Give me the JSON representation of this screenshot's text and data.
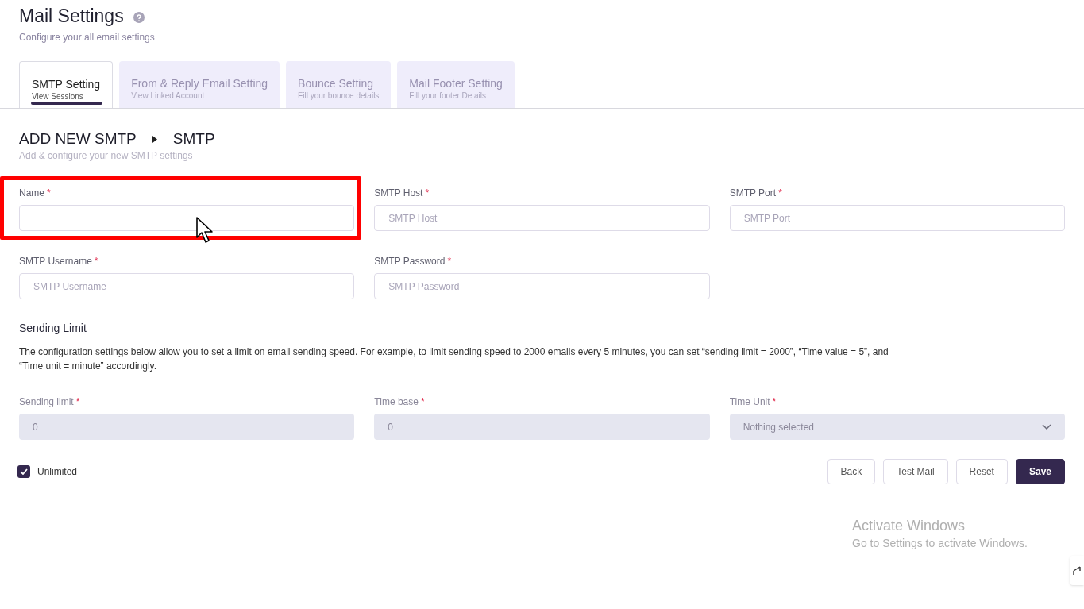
{
  "header": {
    "title": "Mail Settings",
    "subtitle": "Configure your all email settings"
  },
  "tabs": [
    {
      "label": "SMTP Setting",
      "sublabel": "View Sessions",
      "selected": true
    },
    {
      "label": "From & Reply Email Setting",
      "sublabel": "View Linked Account",
      "selected": false
    },
    {
      "label": "Bounce Setting",
      "sublabel": "Fill your bounce details",
      "selected": false
    },
    {
      "label": "Mail Footer Setting",
      "sublabel": "Fill your footer Details",
      "selected": false
    }
  ],
  "breadcrumb": {
    "items": [
      "ADD NEW SMTP",
      "SMTP"
    ],
    "subtitle": "Add & configure your new SMTP settings"
  },
  "smtp_fields": [
    {
      "label": "Name",
      "required_mark": "*",
      "highlighted": true
    },
    {
      "label": "SMTP Host",
      "required_mark": "*",
      "placeholder": "SMTP Host",
      "highlighted": false
    },
    {
      "label": "SMTP Port",
      "required_mark": "*",
      "placeholder": "SMTP Port",
      "highlighted": false
    },
    {
      "label": "SMTP Username",
      "required_mark": "*",
      "placeholder": "SMTP Username",
      "highlighted": false
    },
    {
      "label": "SMTP Password",
      "required_mark": "*",
      "placeholder": "SMTP Password",
      "highlighted": false
    }
  ],
  "sending_limit": {
    "title": "Sending Limit",
    "description": "The configuration settings below allow you to set a limit on email sending speed. For example, to limit sending speed to 2000 emails every 5 minutes, you can set “sending limit = 2000”, “Time value = 5”, and “Time unit = minute” accordingly.",
    "fields": [
      {
        "kind": "input",
        "label": "Sending limit",
        "required_mark": "*",
        "value": "0",
        "disabled": true
      },
      {
        "kind": "input",
        "label": "Time base",
        "required_mark": "*",
        "value": "0",
        "disabled": true
      },
      {
        "kind": "select",
        "label": "Time Unit",
        "required_mark": "*",
        "value": "Nothing selected",
        "disabled": true
      }
    ]
  },
  "unlimited": {
    "label": "Unlimited",
    "checked": true
  },
  "buttons": [
    {
      "label": "Back",
      "kind": "secondary"
    },
    {
      "label": "Test Mail",
      "kind": "secondary"
    },
    {
      "label": "Reset",
      "kind": "secondary"
    },
    {
      "label": "Save",
      "kind": "primary"
    }
  ],
  "os_notice": {
    "title": "Activate Windows",
    "text": "Go to Settings to activate Windows."
  }
}
